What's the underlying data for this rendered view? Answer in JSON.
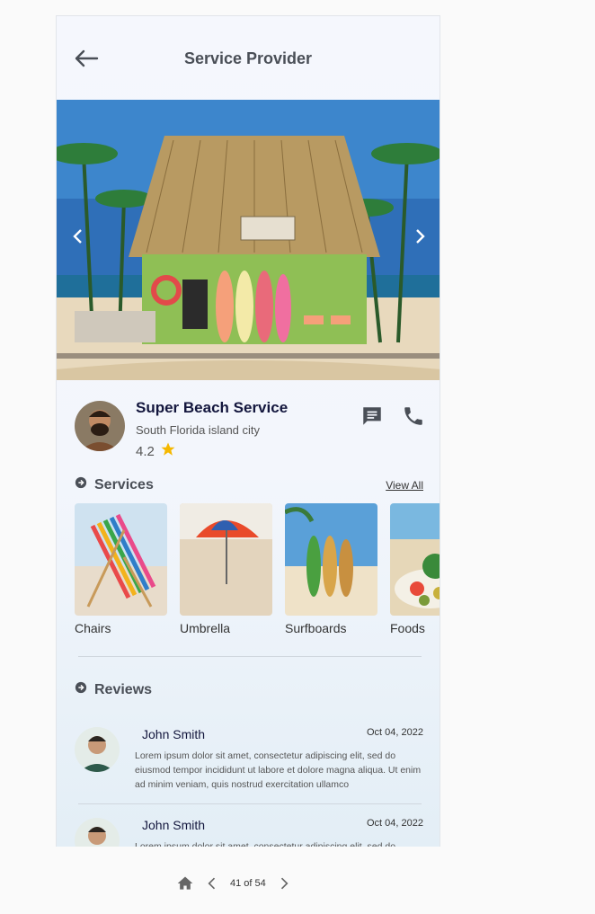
{
  "header": {
    "title": "Service Provider"
  },
  "provider": {
    "name": "Super Beach Service",
    "location": "South Florida island city",
    "rating": "4.2"
  },
  "services_section": {
    "title": "Services",
    "view_all": "View All",
    "items": [
      {
        "label": "Chairs"
      },
      {
        "label": "Umbrella"
      },
      {
        "label": "Surfboards"
      },
      {
        "label": "Foods"
      }
    ]
  },
  "reviews_section": {
    "title": "Reviews",
    "items": [
      {
        "name": "John Smith",
        "date": "Oct 04, 2022",
        "text": "Lorem ipsum dolor sit amet, consectetur adipiscing elit, sed do eiusmod tempor incididunt ut labore et dolore magna aliqua. Ut enim ad minim veniam, quis nostrud exercitation ullamco"
      },
      {
        "name": "John Smith",
        "date": "Oct 04, 2022",
        "text": "Lorem ipsum dolor sit amet, consectetur adipiscing elit, sed do"
      }
    ]
  },
  "pager": {
    "label": "41 of 54"
  },
  "colors": {
    "accent": "#13163d",
    "star": "#f5b800",
    "icon": "#4a4f57"
  }
}
